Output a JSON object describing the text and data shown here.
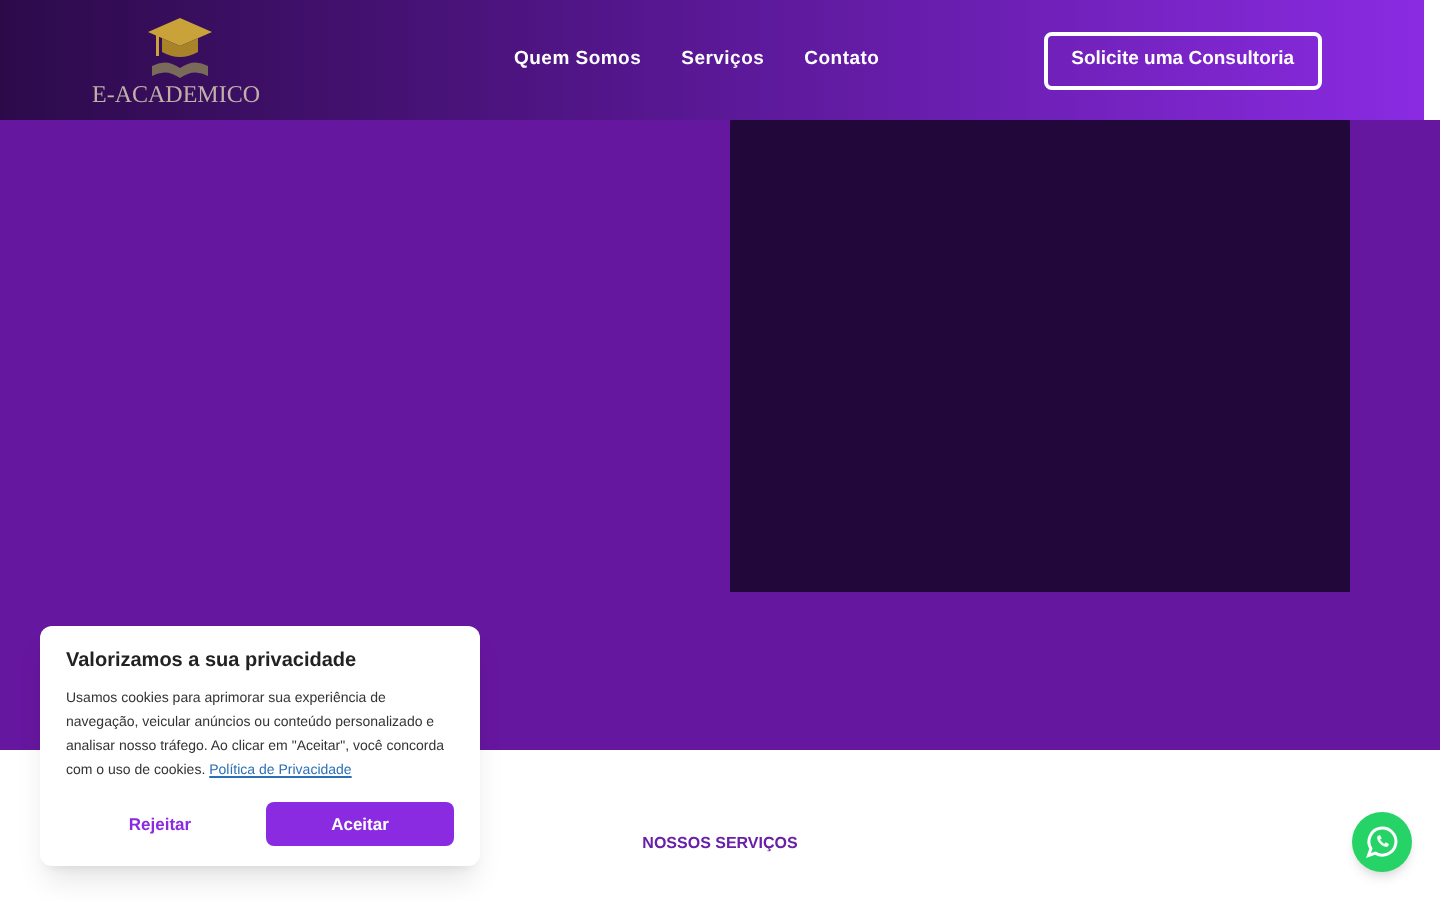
{
  "header": {
    "logo_text": "E-ACADEMICO",
    "nav": [
      {
        "label": "Quem Somos"
      },
      {
        "label": "Serviços"
      },
      {
        "label": "Contato"
      }
    ],
    "cta": "Solicite uma Consultoria"
  },
  "hero": {
    "media": {
      "kind": "video"
    }
  },
  "services": {
    "eyebrow": "NOSSOS SERVIÇOS"
  },
  "cookie_banner": {
    "title": "Valorizamos a sua privacidade",
    "text": "Usamos cookies para aprimorar sua experiência de navegação, veicular anúncios ou conteúdo personalizado e analisar nosso tráfego. Ao clicar em \"Aceitar\", você concorda com o uso de cookies.",
    "link": "Política de Privacidade",
    "buttons": [
      {
        "label": "Rejeitar",
        "kind": "secondary"
      },
      {
        "label": "Aceitar",
        "kind": "primary"
      }
    ]
  }
}
